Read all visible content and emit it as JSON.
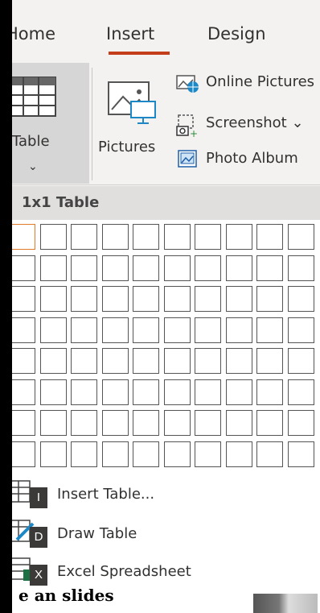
{
  "tabs": {
    "home": "Home",
    "insert": "Insert",
    "design": "Design"
  },
  "ribbon": {
    "table_label": "Table",
    "table_chevron": "⌄",
    "pictures_label": "Pictures",
    "online_pictures": "Online Pictures",
    "screenshot": "Screenshot ⌄",
    "photo_album": "Photo Album"
  },
  "dropdown": {
    "header": "1x1 Table",
    "grid": {
      "columns": 10,
      "rows": 8,
      "selected_columns": 1,
      "selected_rows": 1
    },
    "items": [
      {
        "label": "Insert Table...",
        "key": "I"
      },
      {
        "label": "Draw Table",
        "key": "D"
      },
      {
        "label": "Excel Spreadsheet",
        "key": "X"
      }
    ]
  },
  "background_fragment": "e an slides",
  "colors": {
    "accent": "#c43e1c",
    "grid_highlight": "#e37c2a",
    "header_bg": "#e1dfdd"
  }
}
